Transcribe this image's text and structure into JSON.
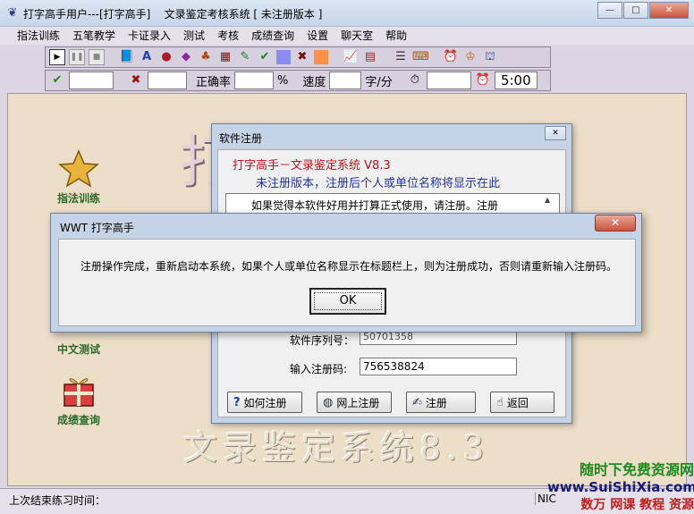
{
  "window": {
    "title": "打字高手用户---[打字高手]    文录鉴定考核系统 [ 未注册版本 ]",
    "controls": {
      "minimize": "—",
      "maximize": "□",
      "close": "✕"
    }
  },
  "menu": [
    "指法训练",
    "五笔教学",
    "卡证录入",
    "测试",
    "考核",
    "成绩查询",
    "设置",
    "聊天室",
    "帮助"
  ],
  "toolbar": {
    "accuracy_label": "正确率",
    "percent_unit": "%",
    "speed_label": "速度",
    "speed_unit": "字/分",
    "timer_value": "5:00"
  },
  "sidebar": [
    {
      "label": "指法训练",
      "icon": "star-icon"
    },
    {
      "label": "中文测试",
      "icon": "test-icon"
    },
    {
      "label": "成绩查询",
      "icon": "gift-icon"
    }
  ],
  "background_title": "文录鉴定系统8.3",
  "status": {
    "last_practice": "上次结束练习时间：",
    "right": "NIC"
  },
  "stamp": {
    "line1": "随时下免费资源网",
    "line2": "www.SuiShiXia.com",
    "line3": "数万 网课 教程 资源"
  },
  "reg_dialog": {
    "title": "软件注册",
    "heading": "打字高手－文录鉴定系统 V8.3",
    "subheading": "未注册版本，注册后个人或单位名称将显示在此",
    "notice": "如果觉得本软件好用并打算正式使用，请注册。注册",
    "serial_label": "软件序列号：",
    "serial_value": "50701358",
    "code_label": "输入注册码:",
    "code_value": "756538824",
    "buttons": [
      "如何注册",
      "网上注册",
      "注册",
      "返回"
    ]
  },
  "msg_dialog": {
    "title": "WWT 打字高手",
    "message": "注册操作完成，重新启动本系统，如果个人或单位名称显示在标题栏上，则为注册成功，否则请重新输入注册码。",
    "ok_label": "OK",
    "close_label": "✕"
  }
}
